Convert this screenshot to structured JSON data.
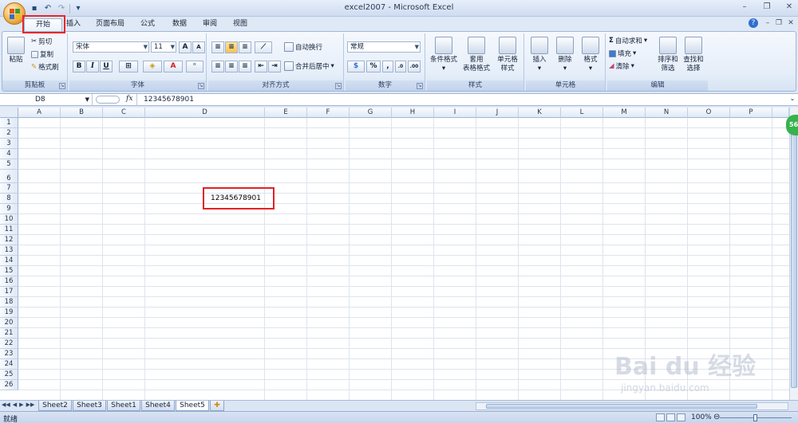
{
  "window": {
    "title": "excel2007 - Microsoft Excel"
  },
  "tabs": [
    "开始",
    "插入",
    "页面布局",
    "公式",
    "数据",
    "审阅",
    "视图"
  ],
  "ribbon": {
    "clipboard": {
      "label": "剪贴板",
      "paste": "粘贴",
      "cut": "剪切",
      "copy": "复制",
      "format_painter": "格式刷"
    },
    "font": {
      "label": "字体",
      "font_name": "宋体",
      "font_size": "11",
      "bold": "B",
      "italic": "I",
      "underline": "U"
    },
    "alignment": {
      "label": "对齐方式",
      "wrap": "自动换行",
      "merge": "合并后居中"
    },
    "number": {
      "label": "数字",
      "format": "常规",
      "percent": "%"
    },
    "styles": {
      "label": "样式",
      "conditional": "条件格式",
      "table_line1": "套用",
      "table_line2": "表格格式",
      "cell_line1": "单元格",
      "cell_line2": "样式"
    },
    "cells": {
      "label": "单元格",
      "insert": "插入",
      "delete": "删除",
      "format": "格式"
    },
    "editing": {
      "label": "编辑",
      "autosum": "自动求和",
      "fill": "填充",
      "clear": "清除",
      "sort_line1": "排序和",
      "sort_line2": "筛选",
      "find_line1": "查找和",
      "find_line2": "选择"
    }
  },
  "formula_bar": {
    "name_box": "D8",
    "fx": "fx",
    "value": "12345678901"
  },
  "grid": {
    "columns": [
      "A",
      "B",
      "C",
      "D",
      "E",
      "F",
      "G",
      "H",
      "I",
      "J",
      "K",
      "L",
      "M",
      "N",
      "O",
      "P"
    ],
    "rows": [
      "1",
      "2",
      "3",
      "4",
      "5",
      "6",
      "7",
      "8",
      "9",
      "10",
      "11",
      "12",
      "13",
      "14",
      "15",
      "16",
      "17",
      "18",
      "19",
      "20",
      "21",
      "22",
      "23",
      "24",
      "25",
      "26"
    ],
    "d8_value": "12345678901"
  },
  "sheets": [
    "Sheet2",
    "Sheet3",
    "Sheet1",
    "Sheet4",
    "Sheet5"
  ],
  "active_sheet": "Sheet5",
  "status": {
    "text": "就绪",
    "zoom": "100%"
  },
  "badge": "56",
  "watermark": {
    "brand": "Bai du 经验",
    "url": "jingyan.baidu.com"
  },
  "colors": {
    "highlight": "#e02326",
    "ribbon_bg": "#e6eef9",
    "badge": "#37b24d"
  }
}
